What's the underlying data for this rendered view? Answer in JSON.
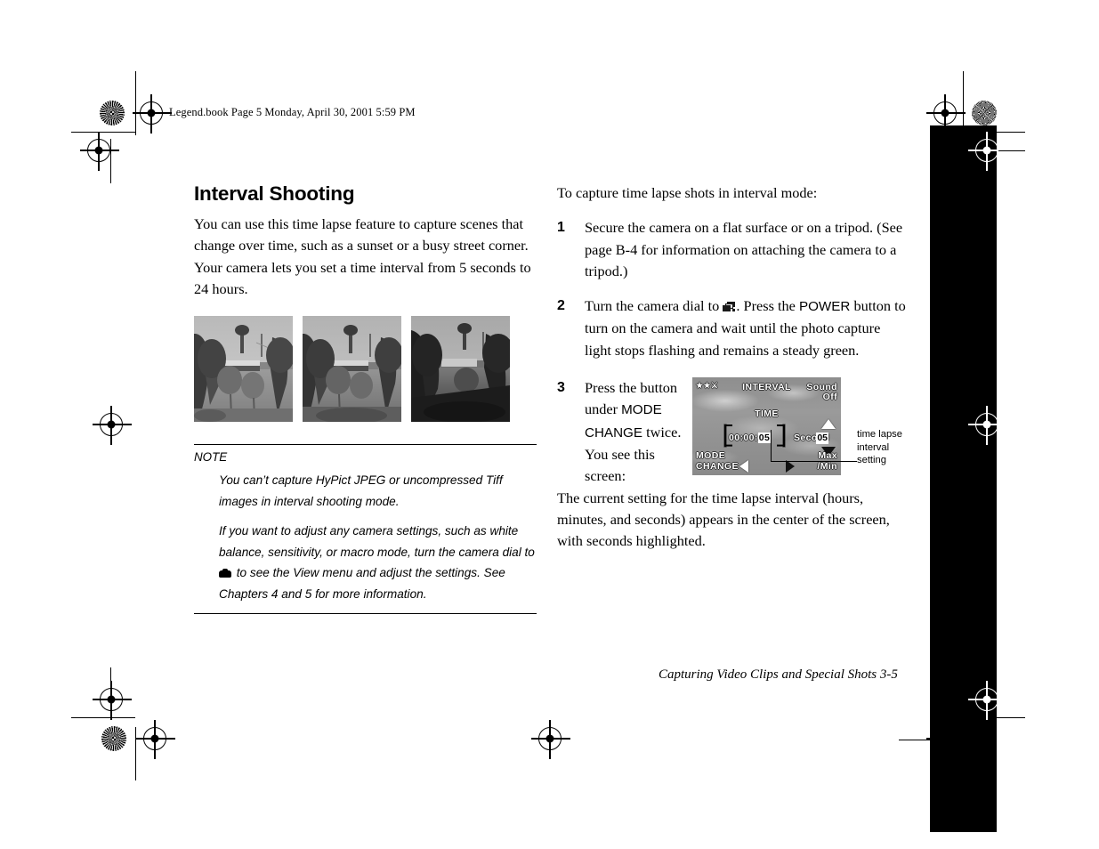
{
  "running_head": "Legend.book  Page 5  Monday, April 30, 2001  5:59 PM",
  "left_column": {
    "title": "Interval Shooting",
    "intro": "You can use this time lapse feature to capture scenes that change over time, such as a sunset or a busy street corner. Your camera lets you set a time interval from 5 seconds to 24 hours.",
    "photos": [
      {
        "caption": "time lapse frame 1 — park at daytime"
      },
      {
        "caption": "time lapse frame 2 — park slightly later"
      },
      {
        "caption": "time lapse frame 3 — park at dusk"
      }
    ],
    "note": {
      "label": "NOTE",
      "paragraph_1": "You can’t capture HyPict JPEG or uncompressed Tiff images in interval shooting mode.",
      "paragraph_2a": "If you want to adjust any camera settings, such as white balance, sensitivity, or macro mode, turn the camera dial to",
      "paragraph_2b": "to see the View menu and adjust the settings. See Chapters 4 and 5 for more information."
    }
  },
  "right_column": {
    "lead_in": "To capture time lapse shots in interval mode:",
    "steps": [
      {
        "number": "1",
        "text": "Secure the camera on a flat surface or on a tripod. (See page B-4 for information on attaching the camera to a tripod.)"
      },
      {
        "number": "2",
        "text_a": "Turn the camera dial to",
        "text_b": ". Press the",
        "emphasis": "POWER",
        "text_c": "button to turn on the camera and wait until the photo capture light stops flashing and remains a steady green."
      },
      {
        "number": "3",
        "text_a": "Press the button under",
        "emphasis": "MODE CHANGE",
        "text_b": "twice. You see this screen:"
      }
    ],
    "closing": "The current setting for the time lapse interval (hours, minutes, and seconds) appears in the center of the screen, with seconds highlighted."
  },
  "lcd": {
    "title": "INTERVAL",
    "sound_label": "Sound",
    "sound_value": "Off",
    "time_label": "TIME",
    "clock_hours": "00",
    "clock_sep1": ":",
    "clock_minutes": "00",
    "clock_sep2": ":",
    "clock_seconds": "05",
    "unit_label": "Second",
    "unit_value": "05",
    "button_left_line1": "MODE",
    "button_left_line2": "CHANGE",
    "button_right_line1": "Max",
    "button_right_line2": "/Min"
  },
  "callout": {
    "line1": "time lapse",
    "line2": "interval",
    "line3": "setting"
  },
  "footer": "Capturing Video Clips and Special Shots  3-5",
  "colors": {
    "page_background": "#ffffff",
    "text": "#000000",
    "thumb_tab": "#000000",
    "lcd_background": "#939393",
    "lcd_text": "#ffffff",
    "lcd_highlight_bg": "#ffffff",
    "lcd_highlight_text": "#000000"
  }
}
